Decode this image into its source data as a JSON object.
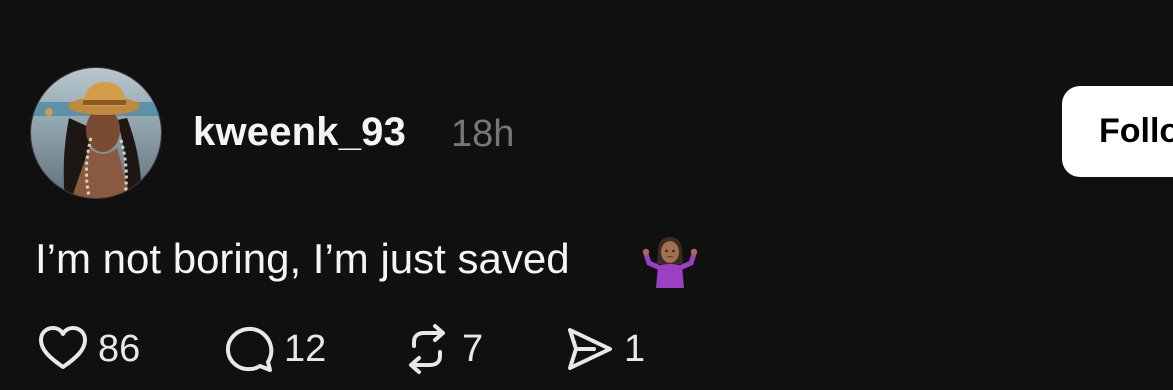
{
  "post": {
    "author": {
      "username": "kweenk_93",
      "timestamp": "18h",
      "avatar_icon": "profile-photo-avatar"
    },
    "follow_label": "Follow",
    "text": "I’m not boring, I’m just saved",
    "emoji_icon": "person-shrugging-emoji",
    "actions": {
      "like": {
        "icon": "heart-icon",
        "count": "86"
      },
      "reply": {
        "icon": "comment-bubble-icon",
        "count": "12"
      },
      "repost": {
        "icon": "repost-icon",
        "count": "7"
      },
      "share": {
        "icon": "send-icon",
        "count": "1"
      }
    }
  },
  "colors": {
    "background": "#101010",
    "primary_text": "#f3f5f7",
    "secondary_text": "#777777",
    "button_bg": "#ffffff",
    "emoji_purple": "#9b3fc4"
  }
}
